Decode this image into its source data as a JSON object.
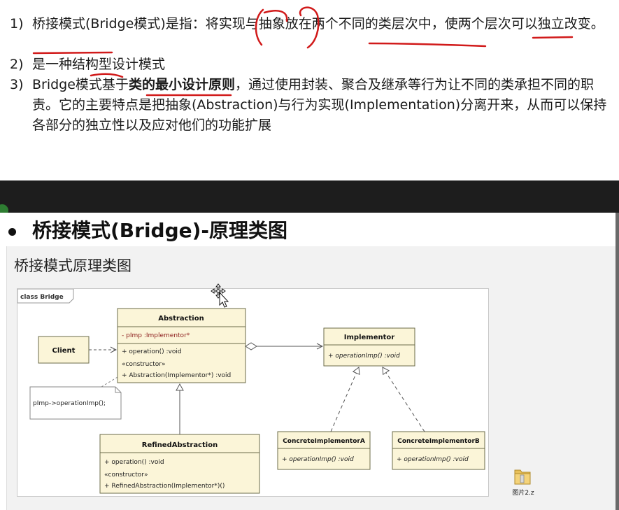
{
  "item1": {
    "num": "1)",
    "text": "桥接模式(Bridge模式)是指：将实现与抽象放在两个不同的类层次中，使两个层次可以独立改变。"
  },
  "item2": {
    "num": "2)",
    "text": "是一种结构型设计模式"
  },
  "item3": {
    "num": "3)",
    "pre": "Bridge模式基于",
    "bold": "类的最小设计原则",
    "post": "，通过使用封装、聚合及继承等行为让不同的类承担不同的职责。它的主要特点是把抽象(Abstraction)与行为实现(Implementation)分离开来，从而可以保持各部分的独立性以及应对他们的功能扩展"
  },
  "slide": {
    "title": "桥接模式(Bridge)-原理类图",
    "panel_title": "桥接模式原理类图"
  },
  "diagram": {
    "frame_label": "class Bridge",
    "client": "Client",
    "abstraction": {
      "name": "Abstraction",
      "attr": "-   pImp  :Implementor*",
      "op": "+   operation()  :void",
      "stereotype": "«constructor»",
      "ctor": "+   Abstraction(Implementor*)  :void"
    },
    "implementor": {
      "name": "Implementor",
      "op": "+   operationImp()  :void"
    },
    "refined": {
      "name": "RefinedAbstraction",
      "op": "+   operation()  :void",
      "stereotype": "«constructor»",
      "ctor": "+   RefinedAbstraction(Implementor*)()"
    },
    "concrete_a": {
      "name": "ConcreteImplementorA",
      "op": "+   operationImp()  :void"
    },
    "concrete_b": {
      "name": "ConcreteImplementorB",
      "op": "+   operationImp()  :void"
    },
    "note": "pImp->operationImp();"
  },
  "desktop": {
    "file_label": "图片2.z"
  },
  "colors": {
    "class_fill": "#fbf5d8",
    "class_border": "#6b6b4a",
    "annotation_red": "#d11a1a",
    "dark_band": "#1d1d1d"
  },
  "icons": [
    "move-cursor-icon",
    "folder-icon"
  ]
}
